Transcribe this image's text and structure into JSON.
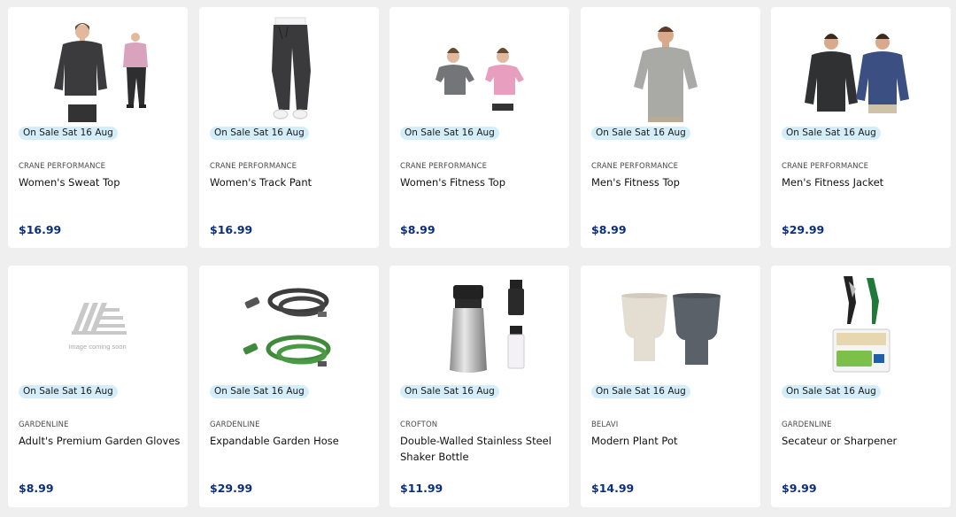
{
  "products": [
    {
      "badge": "On Sale Sat 16 Aug",
      "brand": "CRANE PERFORMANCE",
      "name": "Women's Sweat Top",
      "price": "$16.99"
    },
    {
      "badge": "On Sale Sat 16 Aug",
      "brand": "CRANE PERFORMANCE",
      "name": "Women's Track Pant",
      "price": "$16.99"
    },
    {
      "badge": "On Sale Sat 16 Aug",
      "brand": "CRANE PERFORMANCE",
      "name": "Women's Fitness Top",
      "price": "$8.99"
    },
    {
      "badge": "On Sale Sat 16 Aug",
      "brand": "CRANE PERFORMANCE",
      "name": "Men's Fitness Top",
      "price": "$8.99"
    },
    {
      "badge": "On Sale Sat 16 Aug",
      "brand": "CRANE PERFORMANCE",
      "name": "Men's Fitness Jacket",
      "price": "$29.99"
    },
    {
      "badge": "On Sale Sat 16 Aug",
      "brand": "GARDENLINE",
      "name": "Adult's Premium Garden Gloves",
      "price": "$8.99",
      "image_text": "Image coming soon"
    },
    {
      "badge": "On Sale Sat 16 Aug",
      "brand": "GARDENLINE",
      "name": "Expandable Garden Hose",
      "price": "$29.99"
    },
    {
      "badge": "On Sale Sat 16 Aug",
      "brand": "CROFTON",
      "name": "Double-Walled Stainless Steel Shaker Bottle",
      "price": "$11.99"
    },
    {
      "badge": "On Sale Sat 16 Aug",
      "brand": "BELAVI",
      "name": "Modern Plant Pot",
      "price": "$14.99"
    },
    {
      "badge": "On Sale Sat 16 Aug",
      "brand": "GARDENLINE",
      "name": "Secateur or Sharpener",
      "price": "$9.99"
    }
  ],
  "colors": {
    "price": "#0a2e82",
    "badge_bg": "#d4eef9",
    "page_bg": "#efefef"
  }
}
